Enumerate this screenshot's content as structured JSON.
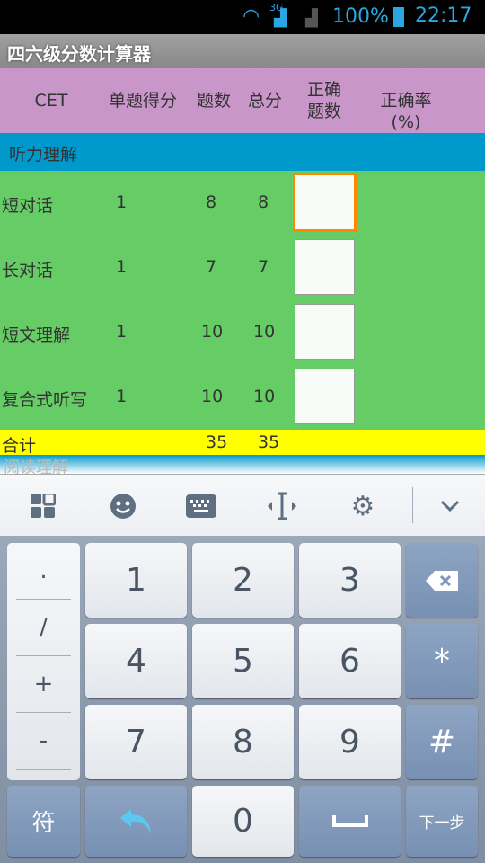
{
  "status": {
    "battery": "100%",
    "time": "22:17",
    "network": "3G"
  },
  "app": {
    "title": "四六级分数计算器"
  },
  "header": [
    "CET",
    "单题得分",
    "题数",
    "总分",
    "正确\n题数",
    "正确率(%)"
  ],
  "header_correct_line1": "正确",
  "header_correct_line2": "题数",
  "section": "听力理解",
  "rows": [
    {
      "name": "短对话",
      "score": "1",
      "count": "8",
      "total": "8"
    },
    {
      "name": "长对话",
      "score": "1",
      "count": "7",
      "total": "7"
    },
    {
      "name": "短文理解",
      "score": "1",
      "count": "10",
      "total": "10"
    },
    {
      "name": "复合式听写",
      "score": "1",
      "count": "10",
      "total": "10"
    }
  ],
  "total": {
    "label": "合计",
    "count": "35",
    "total": "35"
  },
  "next_section": "阅读理解",
  "keyboard": {
    "symbols": [
      ".",
      "/",
      "+",
      "-"
    ],
    "digits": [
      "1",
      "2",
      "3",
      "4",
      "5",
      "6",
      "7",
      "8",
      "9",
      "0"
    ],
    "star": "*",
    "hash": "#",
    "sym": "符",
    "next": "下一步"
  },
  "colors": {
    "header": "#c896c8",
    "section": "#0099cc",
    "rows": "#66cc66",
    "total": "#ffff00",
    "focus": "#ff8800"
  }
}
